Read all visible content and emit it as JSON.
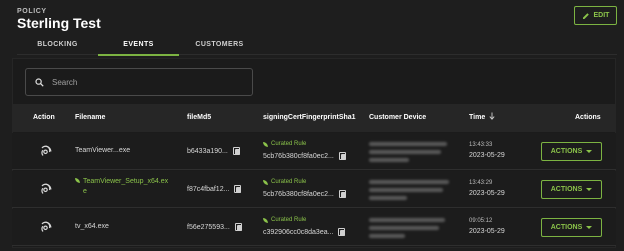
{
  "header": {
    "overline": "POLICY",
    "title": "Sterling Test",
    "edit_label": "EDIT"
  },
  "tabs": [
    {
      "label": "BLOCKING",
      "active": false
    },
    {
      "label": "EVENTS",
      "active": true
    },
    {
      "label": "CUSTOMERS",
      "active": false
    }
  ],
  "search": {
    "placeholder": "Search"
  },
  "table": {
    "columns": {
      "action": "Action",
      "filename": "Filename",
      "md5": "fileMd5",
      "cert": "signingCertFingerprintSha1",
      "device": "Customer Device",
      "time": "Time",
      "actions": "Actions"
    },
    "sort_icon": "arrow-down-icon",
    "rows": [
      {
        "filename_line1": "TeamViewer...exe",
        "filename_line2": "",
        "filename_is_link": false,
        "md5": "b6433a190...",
        "cert_tag": "",
        "cert": "5cb76b380cf8fa0ec2...",
        "time": "13:43:33",
        "date": "2023-05-29",
        "actions_label": "ACTIONS"
      },
      {
        "filename_line1": "TeamViewer_Setup_x64.ex",
        "filename_line2": "e",
        "filename_is_link": true,
        "md5": "f87c4fbaf12...",
        "cert_tag": "Curated Rule",
        "cert": "5cb76b380cf8fa0ec2...",
        "time": "13:43:29",
        "date": "2023-05-29",
        "actions_label": "ACTIONS"
      },
      {
        "filename_line1": "tv_x64.exe",
        "filename_line2": "",
        "filename_is_link": false,
        "md5": "f56e275593...",
        "cert_tag": "Curated Rule",
        "cert": "c392906cc0c8da3ea...",
        "time": "09:05:12",
        "date": "2023-05-29",
        "actions_label": "ACTIONS"
      }
    ],
    "row0_cert_tag": "Curated Rule"
  },
  "colors": {
    "accent": "#8bc34a",
    "background": "#1e1e1e",
    "header_row": "#262626"
  }
}
